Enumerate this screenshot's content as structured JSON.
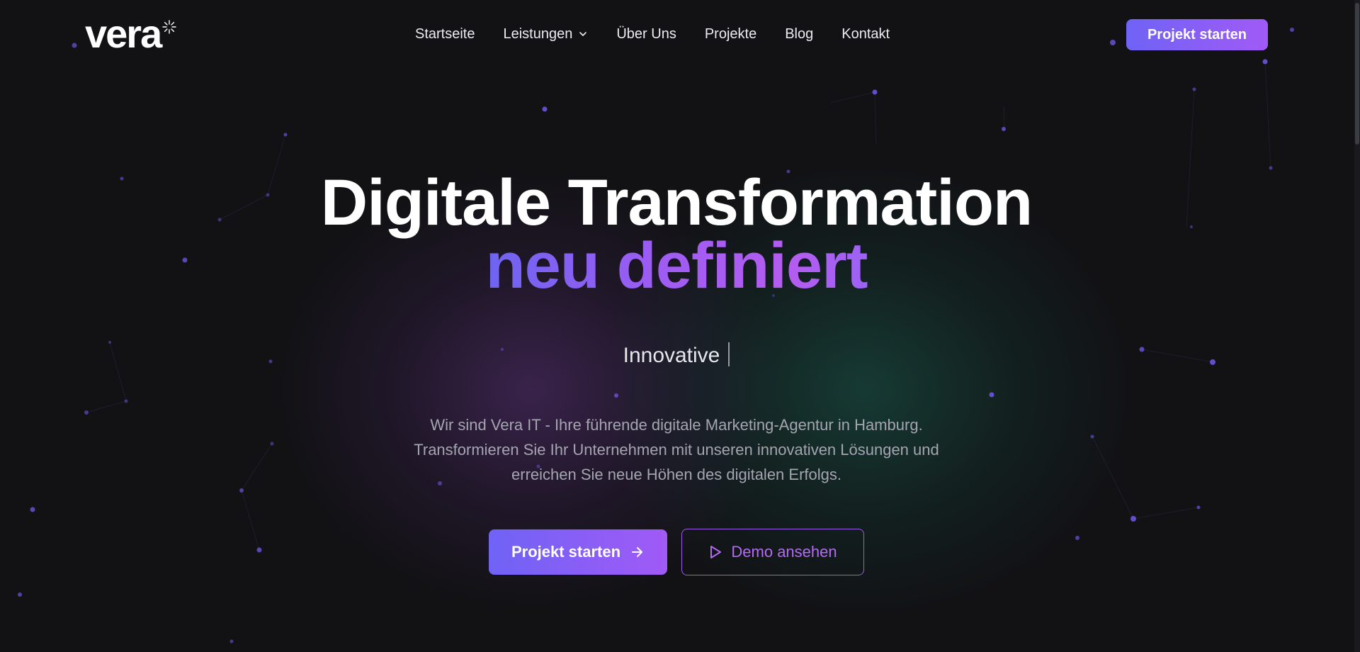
{
  "brand": {
    "logo_text": "vera"
  },
  "nav": {
    "items": [
      {
        "label": "Startseite"
      },
      {
        "label": "Leistungen",
        "has_dropdown": true
      },
      {
        "label": "Über Uns"
      },
      {
        "label": "Projekte"
      },
      {
        "label": "Blog"
      },
      {
        "label": "Kontakt"
      }
    ],
    "cta_label": "Projekt starten"
  },
  "hero": {
    "title_line1": "Digitale Transformation",
    "title_line2": "neu definiert",
    "typing_word": "Innovative",
    "description_lines": [
      "Wir sind Vera IT - Ihre führende digitale Marketing-Agentur in Hamburg.",
      "Transformieren Sie Ihr Unternehmen mit unseren innovativen Lösungen und",
      "erreichen Sie neue Höhen des digitalen Erfolgs."
    ],
    "primary_button": "Projekt starten",
    "secondary_button": "Demo ansehen"
  },
  "icons": {
    "nav_dropdown": "chevron-down-icon",
    "primary_button": "arrow-right-icon",
    "secondary_button": "play-icon",
    "logo_mark": "sparkle-icon"
  },
  "colors": {
    "background": "#121215",
    "accent_start": "#6f63f5",
    "accent_end": "#a15af6",
    "outline_accent": "#9a5ce8",
    "text_primary": "#ffffff",
    "text_muted": "#a5a5b1"
  }
}
